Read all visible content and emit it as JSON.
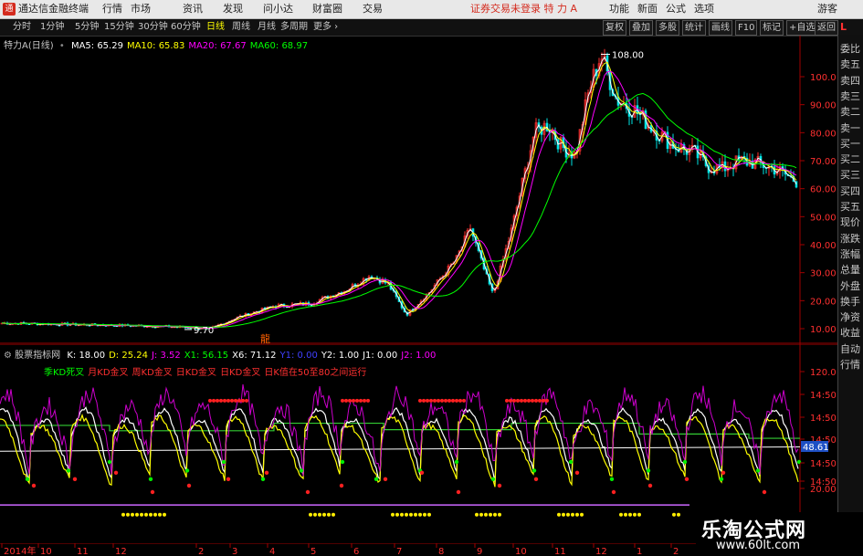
{
  "titlebar": {
    "app_name": "通达信金融终端",
    "menus": [
      "行情",
      "市场",
      "资讯",
      "发现",
      "问小达",
      "财富圈",
      "交易"
    ],
    "login_note": "证券交易未登录 特 力 A",
    "tools": [
      "功能",
      "新面",
      "公式",
      "选项"
    ],
    "guest": "游客"
  },
  "toolbar": {
    "periods": [
      "分时",
      "1分钟",
      "5分钟",
      "15分钟",
      "30分钟",
      "60分钟",
      "日线",
      "周线",
      "月线",
      "多周期",
      "更多"
    ],
    "active_period": "日线",
    "right_tools": [
      "复权",
      "叠加",
      "多股",
      "统计",
      "画线",
      "F10",
      "标记",
      "+自选",
      "返回"
    ]
  },
  "price_panel": {
    "stock": "特力A(日线)",
    "ma": [
      {
        "label": "MA5: 65.29",
        "color": "#ffffff"
      },
      {
        "label": "MA10: 65.83",
        "color": "#ffff00"
      },
      {
        "label": "MA20: 67.67",
        "color": "#ff00ff"
      },
      {
        "label": "MA60: 68.97",
        "color": "#00ff00"
      }
    ],
    "y_ticks": [
      "100.0",
      "90.00",
      "80.00",
      "70.00",
      "60.00",
      "50.00",
      "40.00",
      "30.00",
      "20.00",
      "10.00"
    ],
    "high_label": "108.00",
    "low_label": "9.70",
    "marker": "龍"
  },
  "indicator_panel": {
    "name": "股票指标网",
    "values": [
      {
        "label": "K: 18.00",
        "color": "#ffffff"
      },
      {
        "label": "D: 25.24",
        "color": "#ffff00"
      },
      {
        "label": "J: 3.52",
        "color": "#ff00ff"
      },
      {
        "label": "X1: 56.15",
        "color": "#00ff00"
      },
      {
        "label": "X6: 71.12",
        "color": "#ffffff"
      },
      {
        "label": "Y1: 0.00",
        "color": "#4040ff"
      },
      {
        "label": "Y2: 1.00",
        "color": "#ffffff"
      },
      {
        "label": "J1: 0.00",
        "color": "#ffffff"
      },
      {
        "label": "J2: 1.00",
        "color": "#ff00ff"
      }
    ],
    "legend": [
      {
        "label": "季KD死叉",
        "color": "#00ff00"
      },
      {
        "label": "月KD金叉",
        "color": "#ff3030"
      },
      {
        "label": "周KD金叉",
        "color": "#ff3030"
      },
      {
        "label": "日KD金叉",
        "color": "#ff3030"
      },
      {
        "label": "日KD金叉",
        "color": "#ff3030"
      },
      {
        "label": "日K值在50至80之间运行",
        "color": "#ff3030"
      }
    ],
    "y_ticks": [
      "120.0",
      "14:50",
      "14:50",
      "14:50",
      "48.61",
      "14:50",
      "14:50",
      "20.00"
    ]
  },
  "date_axis": {
    "labels": [
      "2014年",
      "10",
      "11",
      "12",
      "2",
      "3",
      "4",
      "5",
      "6",
      "7",
      "8",
      "9",
      "10",
      "11",
      "12",
      "1",
      "2"
    ]
  },
  "sidebar": {
    "top": "L",
    "items": [
      "委比",
      "卖五",
      "卖四",
      "卖三",
      "卖二",
      "卖一",
      "买一",
      "买二",
      "买三",
      "买四",
      "买五",
      "现价",
      "涨跌",
      "涨幅",
      "总量",
      "外盘",
      "换手",
      "净资",
      "收益",
      "自动",
      "行情"
    ]
  },
  "watermark": {
    "title": "乐淘公式网",
    "url": "www.60lt.com"
  },
  "colors": {
    "up": "#ff3030",
    "down": "#00e5e5",
    "ma5": "#ffffff",
    "ma10": "#ffff00",
    "ma20": "#ff00ff",
    "ma60": "#00ff00",
    "axis": "#a00000"
  }
}
